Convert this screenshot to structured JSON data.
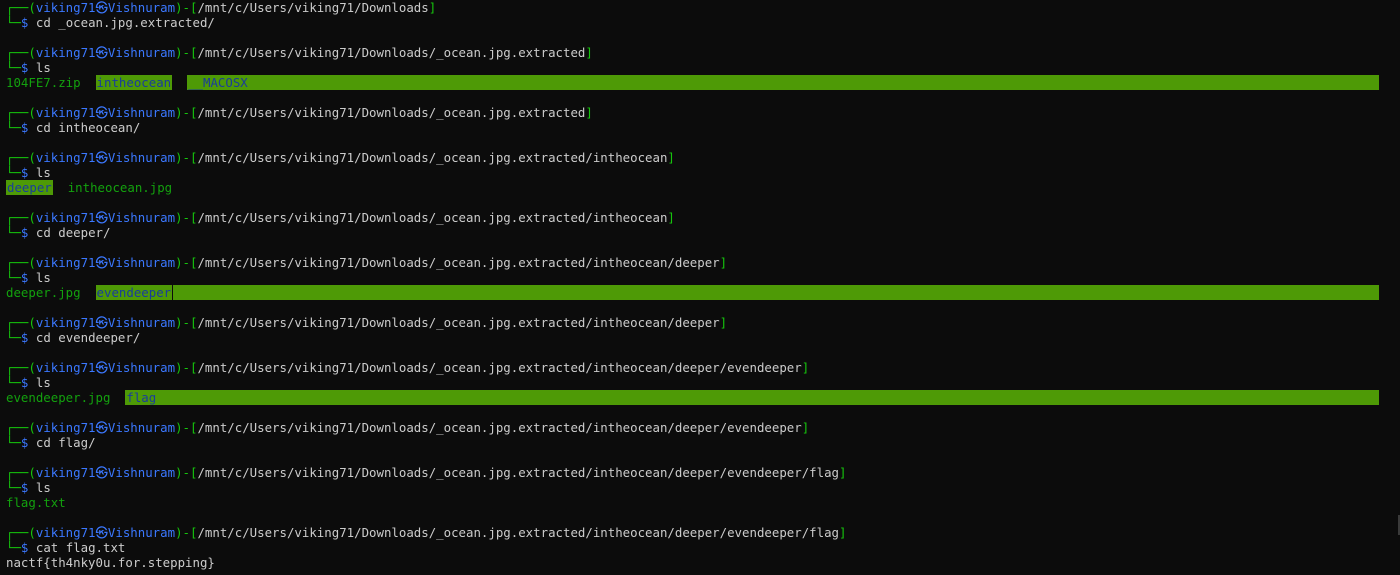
{
  "terminal": {
    "user": "viking71",
    "host": "Vishnuram",
    "prompt_symbol": "$",
    "blocks": [
      {
        "cwd": "/mnt/c/Users/viking71/Downloads",
        "command": "cd _ocean.jpg.extracted/",
        "output": []
      },
      {
        "cwd": "/mnt/c/Users/viking71/Downloads/_ocean.jpg.extracted",
        "command": "ls",
        "output": [
          {
            "text": "104FE7.zip",
            "style": "file"
          },
          {
            "text": "intheocean",
            "style": "dir"
          },
          {
            "text": "__MACOSX",
            "style": "dir"
          }
        ]
      },
      {
        "cwd": "/mnt/c/Users/viking71/Downloads/_ocean.jpg.extracted",
        "command": "cd intheocean/",
        "output": []
      },
      {
        "cwd": "/mnt/c/Users/viking71/Downloads/_ocean.jpg.extracted/intheocean",
        "command": "ls",
        "output": [
          {
            "text": "deeper",
            "style": "dir"
          },
          {
            "text": "intheocean.jpg",
            "style": "file"
          }
        ]
      },
      {
        "cwd": "/mnt/c/Users/viking71/Downloads/_ocean.jpg.extracted/intheocean",
        "command": "cd deeper/",
        "output": []
      },
      {
        "cwd": "/mnt/c/Users/viking71/Downloads/_ocean.jpg.extracted/intheocean/deeper",
        "command": "ls",
        "output": [
          {
            "text": "deeper.jpg",
            "style": "file"
          },
          {
            "text": "evendeeper",
            "style": "dir"
          }
        ]
      },
      {
        "cwd": "/mnt/c/Users/viking71/Downloads/_ocean.jpg.extracted/intheocean/deeper",
        "command": "cd evendeeper/",
        "output": []
      },
      {
        "cwd": "/mnt/c/Users/viking71/Downloads/_ocean.jpg.extracted/intheocean/deeper/evendeeper",
        "command": "ls",
        "output": [
          {
            "text": "evendeeper.jpg",
            "style": "file"
          },
          {
            "text": "flag",
            "style": "dir"
          }
        ]
      },
      {
        "cwd": "/mnt/c/Users/viking71/Downloads/_ocean.jpg.extracted/intheocean/deeper/evendeeper",
        "command": "cd flag/",
        "output": []
      },
      {
        "cwd": "/mnt/c/Users/viking71/Downloads/_ocean.jpg.extracted/intheocean/deeper/evendeeper/flag",
        "command": "ls",
        "output": [
          {
            "text": "flag.txt",
            "style": "file"
          }
        ]
      },
      {
        "cwd": "/mnt/c/Users/viking71/Downloads/_ocean.jpg.extracted/intheocean/deeper/evendeeper/flag",
        "command": "cat flag.txt",
        "output": [
          {
            "text": "nactf{th4nky0u.for.stepping}",
            "style": "plain"
          }
        ]
      }
    ]
  },
  "colors": {
    "background": "#0c0c0c",
    "prompt_frame": "#16c60c",
    "path": "#3b78ff",
    "dir_highlight": "#4e9a06",
    "file": "#13a10e"
  }
}
